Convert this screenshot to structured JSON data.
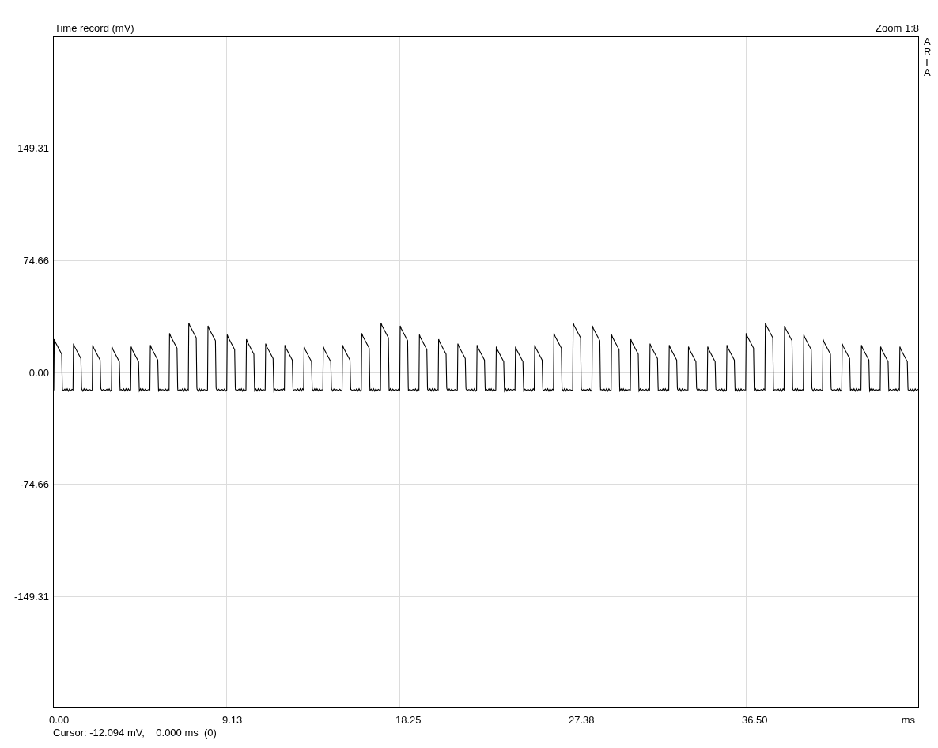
{
  "plot": {
    "title": "Time record (mV)",
    "zoom": "Zoom 1:8",
    "side_label": "ARTA",
    "y_ticks": [
      "149.31",
      "74.66",
      "0.00",
      "-74.66",
      "-149.31"
    ],
    "x_ticks": [
      "0.00",
      "9.13",
      "18.25",
      "27.38",
      "36.50"
    ],
    "x_unit": "ms",
    "cursor": "Cursor: -12.094 mV,    0.000 ms  (0)"
  }
}
